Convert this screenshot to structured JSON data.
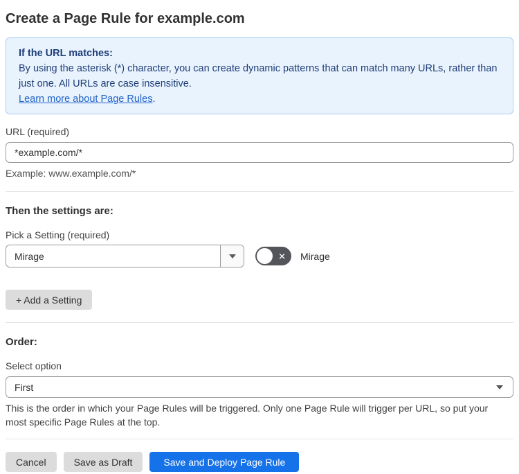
{
  "page": {
    "title": "Create a Page Rule for example.com"
  },
  "info_box": {
    "heading": "If the URL matches:",
    "body": "By using the asterisk (*) character, you can create dynamic patterns that can match many URLs, rather than just one. All URLs are case insensitive.",
    "link_label": "Learn more about Page Rules",
    "link_suffix": "."
  },
  "url_section": {
    "label": "URL (required)",
    "value": "*example.com/*",
    "example": "Example: www.example.com/*"
  },
  "settings_section": {
    "heading": "Then the settings are:",
    "picker_label": "Pick a Setting (required)",
    "selected_setting": "Mirage",
    "toggle_state": "off",
    "toggle_icon": "✕",
    "toggle_label": "Mirage",
    "add_setting_button": "+ Add a Setting"
  },
  "order_section": {
    "heading": "Order:",
    "label": "Select option",
    "selected_option": "First",
    "help_text": "This is the order in which your Page Rules will be triggered. Only one Page Rule will trigger per URL, so put your most specific Page Rules at the top."
  },
  "footer": {
    "cancel_button": "Cancel",
    "save_draft_button": "Save as Draft",
    "save_deploy_button": "Save and Deploy Page Rule"
  },
  "colors": {
    "info_bg": "#e9f3fd",
    "info_border": "#a9cdf2",
    "info_text": "#1e3d78",
    "link": "#2163c9",
    "primary_button": "#1672e8",
    "gray_button": "#dcdcdc",
    "toggle_off": "#54555a"
  }
}
